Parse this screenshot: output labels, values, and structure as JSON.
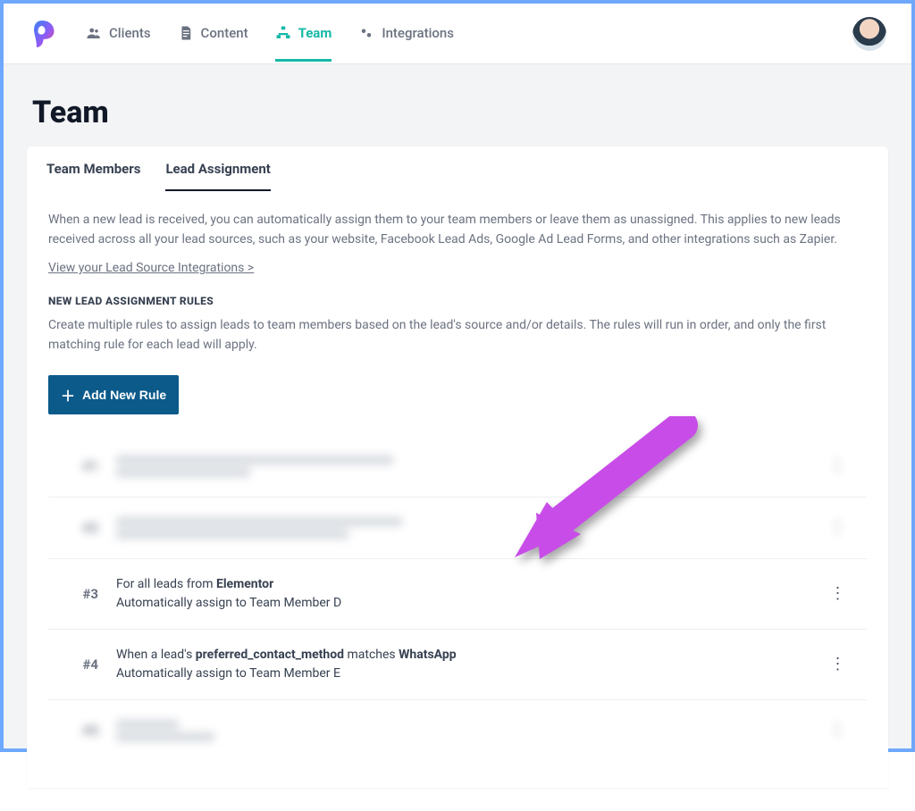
{
  "nav": {
    "clients": "Clients",
    "content": "Content",
    "team": "Team",
    "integrations": "Integrations"
  },
  "page": {
    "title": "Team"
  },
  "tabs": {
    "team_members": "Team Members",
    "lead_assignment": "Lead Assignment"
  },
  "lead_assignment": {
    "description": "When a new lead is received, you can automatically assign them to your team members or leave them as unassigned. This applies to new leads received across all your lead sources, such as your website, Facebook Lead Ads, Google Ad Lead Forms, and other integrations such as Zapier.",
    "view_integrations_link": "View your Lead Source Integrations >",
    "rules_heading": "NEW LEAD ASSIGNMENT RULES",
    "rules_description": "Create multiple rules to assign leads to team members based on the lead's source and/or details. The rules will run in order, and only the first matching rule for each lead will apply.",
    "add_rule_label": "Add New Rule",
    "rules": [
      {
        "num": "#1",
        "blurred": true
      },
      {
        "num": "#2",
        "blurred": true
      },
      {
        "num": "#3",
        "line1_pre": "For all leads from ",
        "line1_bold": "Elementor",
        "line2": "Automatically assign to Team Member D"
      },
      {
        "num": "#4",
        "line1_a": "When a lead's ",
        "line1_b": "preferred_contact_method",
        "line1_c": " matches ",
        "line1_d": "WhatsApp",
        "line2": "Automatically assign to Team Member E"
      },
      {
        "num": "#5",
        "blurred": true
      }
    ]
  },
  "colors": {
    "accent": "#14b8a6",
    "primary_button": "#0b5a8a",
    "annotation": "#c84de8"
  }
}
